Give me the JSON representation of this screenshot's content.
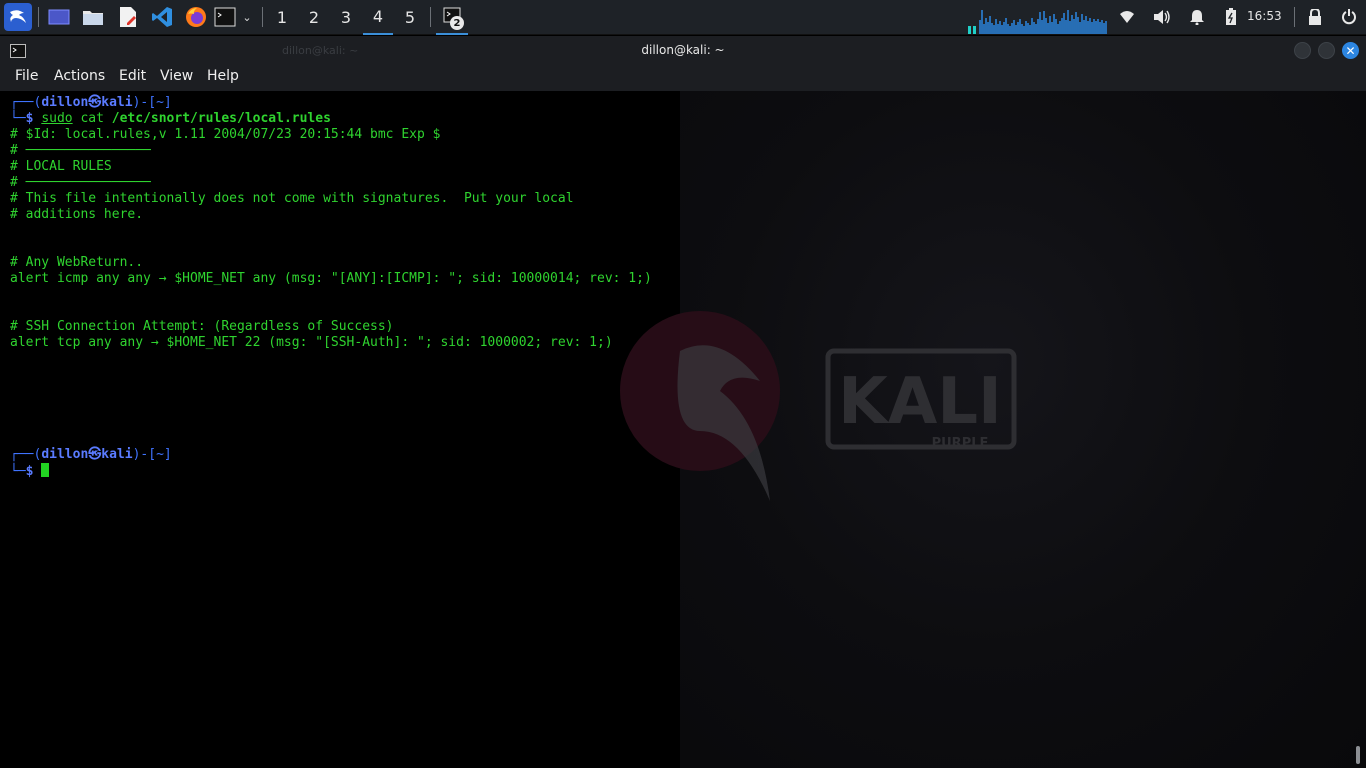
{
  "panel": {
    "workspaces": [
      "1",
      "2",
      "3",
      "4",
      "5"
    ],
    "active_workspace": "4",
    "task_badge": "2",
    "clock": "16:53",
    "icons": [
      "kali-menu-icon",
      "show-desktop-icon",
      "file-manager-icon",
      "text-editor-icon",
      "vscode-icon",
      "firefox-icon",
      "terminal-icon",
      "chevron-down-icon",
      "network-wifi-icon",
      "volume-icon",
      "notifications-bell-icon",
      "battery-icon",
      "lock-icon",
      "power-icon"
    ]
  },
  "window": {
    "title": "dillon@kali: ~",
    "ghost_title": "dillon@kali: ~",
    "menu": [
      "File",
      "Actions",
      "Edit",
      "View",
      "Help"
    ]
  },
  "terminal": {
    "prompt1": {
      "open": "┌──(",
      "user": "dillon㉿kali",
      "close": ")-[~]",
      "second_prefix": "└─",
      "dollar": "$ ",
      "sudo": "sudo",
      "cmd": " cat ",
      "arg": "/etc/snort/rules/local.rules"
    },
    "output": [
      "# $Id: local.rules,v 1.11 2004/07/23 20:15:44 bmc Exp $",
      "# ────────────────",
      "# LOCAL RULES",
      "# ────────────────",
      "# This file intentionally does not come with signatures.  Put your local",
      "# additions here.",
      "",
      "",
      "# Any WebReturn..",
      "alert icmp any any → $HOME_NET any (msg: \"[ANY]:[ICMP]: \"; sid: 10000014; rev: 1;)",
      "",
      "",
      "# SSH Connection Attempt: (Regardless of Success)",
      "alert tcp any any → $HOME_NET 22 (msg: \"[SSH-Auth]: \"; sid: 1000002; rev: 1;)"
    ],
    "prompt2": {
      "open": "┌──(",
      "user": "dillon㉿kali",
      "close": ")-[~]",
      "second_prefix": "└─",
      "dollar": "$ "
    }
  },
  "wallpaper": {
    "logo_text": "KALI",
    "logo_subtext": "PURPLE"
  },
  "colors": {
    "accent": "#3b8fd9",
    "terminal_text": "#2fd32f",
    "prompt_user": "#5a7bff"
  }
}
